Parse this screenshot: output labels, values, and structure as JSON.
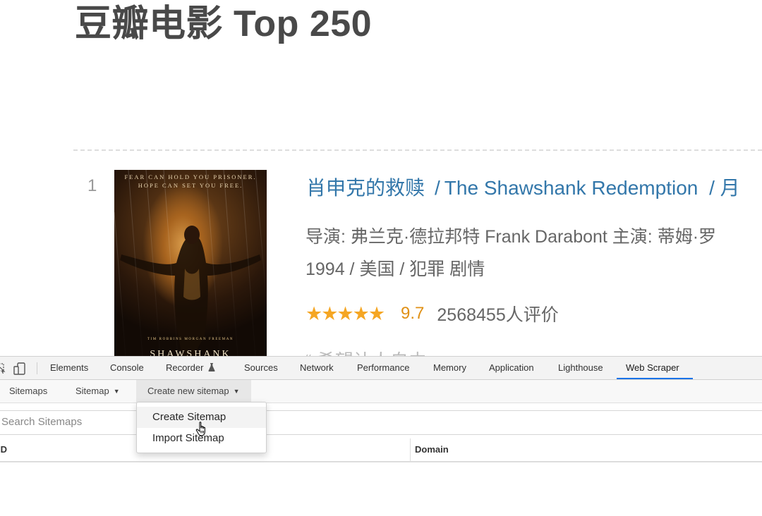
{
  "page": {
    "title": "豆瓣电影 Top 250"
  },
  "movie": {
    "rank": "1",
    "title_cn": "肖申克的救赎",
    "separator": "/",
    "title_en": "The Shawshank Redemption",
    "title_alt": "/ 月",
    "meta_line1": "导演: 弗兰克·德拉邦特 Frank Darabont   主演: 蒂姆·罗",
    "meta_line2": "1994 / 美国 / 犯罪 剧情",
    "stars": "★★★★★",
    "rating_value": 4.85,
    "score": "9.7",
    "votes": "2568455人评价",
    "quote_peek": "“ 希望让人自由",
    "poster": {
      "tagline_1": "FEAR CAN HOLD YOU PRISONER.",
      "tagline_2": "HOPE CAN SET YOU FREE.",
      "credits": "TIM ROBBINS    MORGAN FREEMAN",
      "title": "SHAWSHANK"
    }
  },
  "devtools": {
    "tabs": [
      {
        "label": "Elements"
      },
      {
        "label": "Console"
      },
      {
        "label": "Recorder"
      },
      {
        "label": "Sources"
      },
      {
        "label": "Network"
      },
      {
        "label": "Performance"
      },
      {
        "label": "Memory"
      },
      {
        "label": "Application"
      },
      {
        "label": "Lighthouse"
      },
      {
        "label": "Web Scraper"
      }
    ],
    "active_tab": "Web Scraper",
    "accent_color": "#1a73e8"
  },
  "webscraper": {
    "nav": {
      "sitemaps": "Sitemaps",
      "sitemap": "Sitemap",
      "create_new": "Create new sitemap"
    },
    "search_placeholder": "Search Sitemaps",
    "table_headers": {
      "id": "ID",
      "domain": "Domain"
    },
    "dropdown": {
      "create": "Create Sitemap",
      "import": "Import Sitemap"
    }
  },
  "colors": {
    "link": "#3377aa",
    "star": "#f5a623",
    "score": "#e09015"
  },
  "icons": {
    "inspect": "inspect-element-icon",
    "device": "device-toolbar-icon",
    "recorder": "recorder-flask-icon",
    "cursor": "hand-pointer-icon"
  }
}
